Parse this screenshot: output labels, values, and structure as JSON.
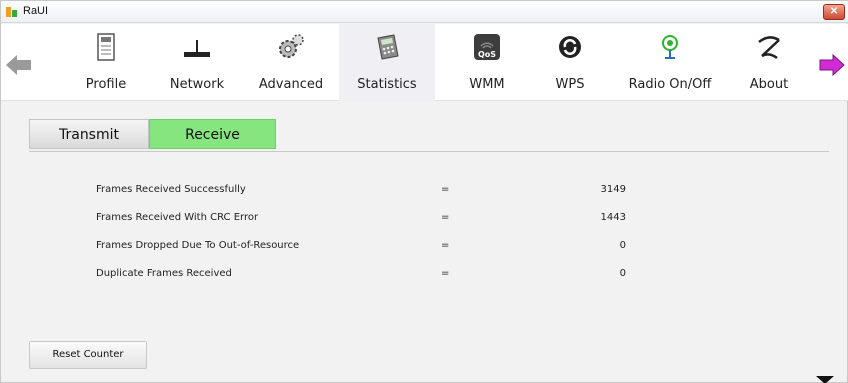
{
  "window": {
    "title": "RaUI",
    "close_label": "✕"
  },
  "toolbar": {
    "items": [
      {
        "label": "Profile",
        "icon": "profile-icon"
      },
      {
        "label": "Network",
        "icon": "network-icon"
      },
      {
        "label": "Advanced",
        "icon": "advanced-gears-icon"
      },
      {
        "label": "Statistics",
        "icon": "statistics-calculator-icon",
        "active": true
      },
      {
        "label": "WMM",
        "icon": "wmm-qos-icon"
      },
      {
        "label": "WPS",
        "icon": "wps-icon"
      },
      {
        "label": "Radio On/Off",
        "icon": "radio-onoff-icon"
      },
      {
        "label": "About",
        "icon": "about-icon"
      }
    ],
    "back_icon": "back-arrow-icon",
    "forward_icon": "forward-arrow-icon"
  },
  "tabs": [
    {
      "label": "Transmit",
      "active": false
    },
    {
      "label": "Receive",
      "active": true
    }
  ],
  "stats": [
    {
      "label": "Frames Received Successfully",
      "eq": "=",
      "value": "3149"
    },
    {
      "label": "Frames Received With CRC Error",
      "eq": "=",
      "value": "1443"
    },
    {
      "label": "Frames Dropped Due To Out-of-Resource",
      "eq": "=",
      "value": "0"
    },
    {
      "label": "Duplicate Frames Received",
      "eq": "=",
      "value": "0"
    }
  ],
  "reset_button": {
    "label": "Reset Counter"
  },
  "colors": {
    "active_tab": "#86e57f",
    "forward_arrow": "#d12bd6",
    "back_arrow": "#9a9a9a"
  }
}
